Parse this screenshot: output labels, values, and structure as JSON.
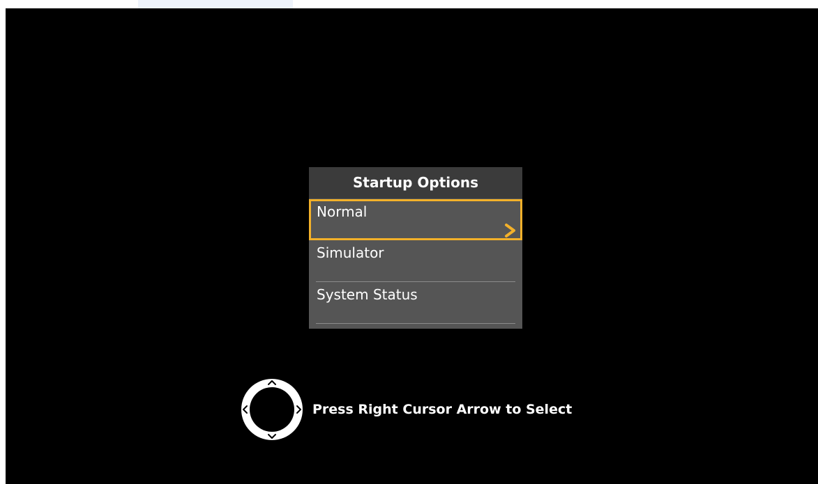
{
  "menu": {
    "title": "Startup Options",
    "items": [
      {
        "label": "Normal",
        "selected": true
      },
      {
        "label": "Simulator",
        "selected": false
      },
      {
        "label": "System Status",
        "selected": false
      }
    ]
  },
  "hint": {
    "text": "Press Right Cursor Arrow to Select",
    "icon": "directional-pad-icon"
  },
  "colors": {
    "background": "#000000",
    "menu_bg": "#555555",
    "menu_header_bg": "#3b3b3b",
    "selection_accent": "#f3b12a",
    "text": "#ffffff"
  }
}
